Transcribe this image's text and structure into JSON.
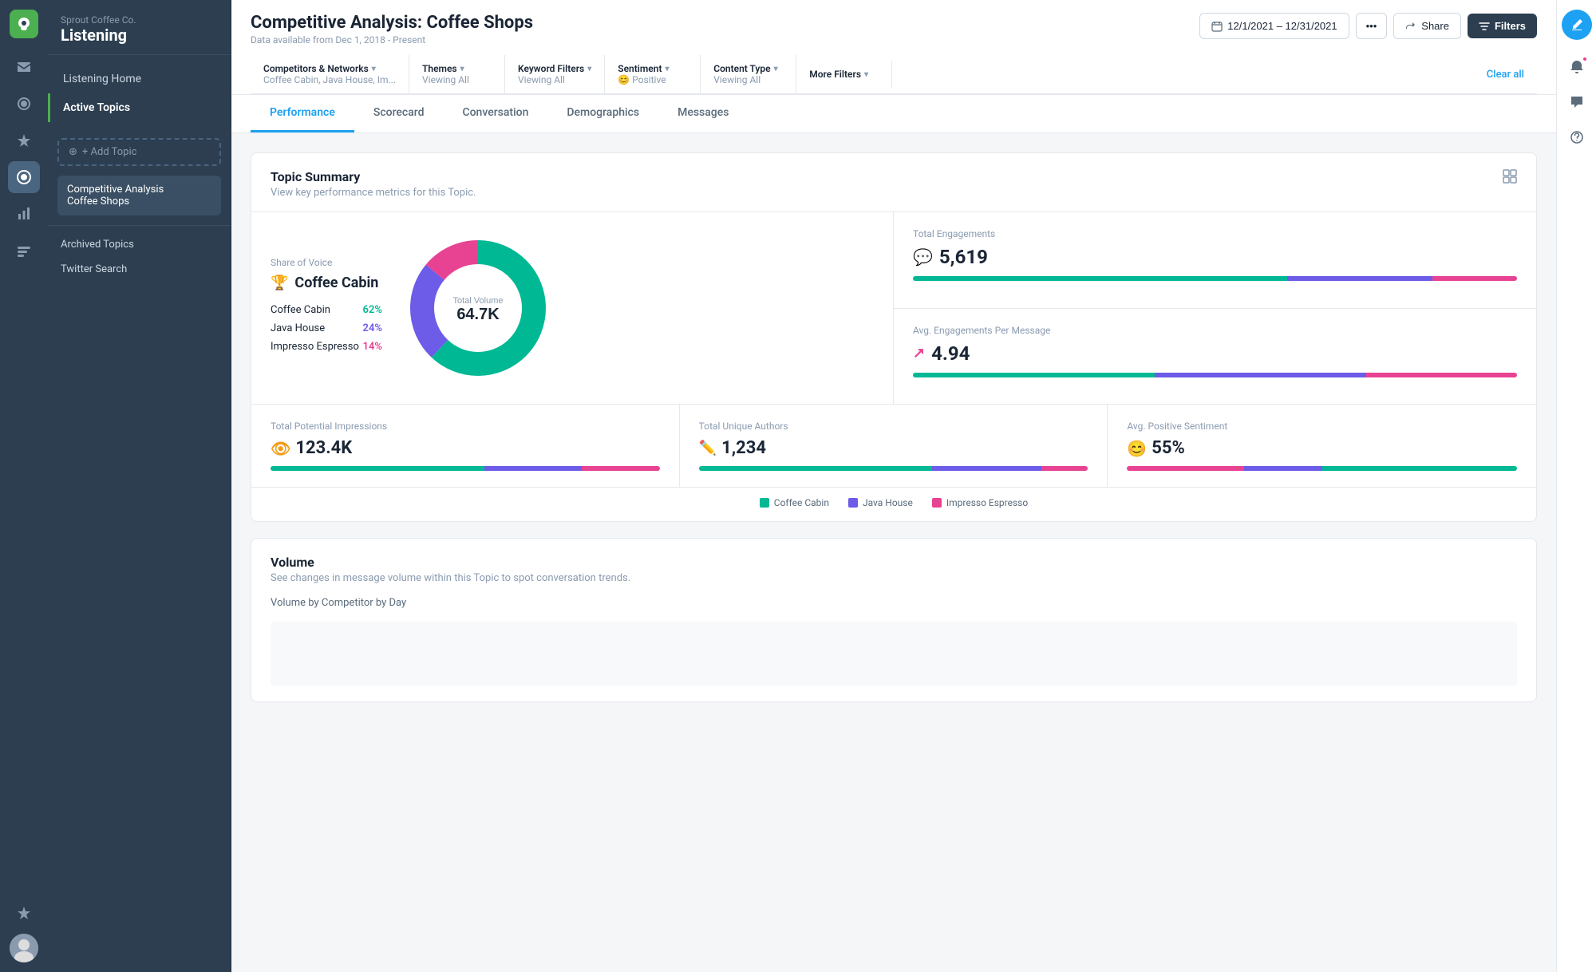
{
  "app": {
    "company": "Sprout Coffee Co.",
    "module": "Listening"
  },
  "sidebar": {
    "nav_items": [
      {
        "id": "listening-home",
        "label": "Listening Home",
        "active": false
      },
      {
        "id": "active-topics",
        "label": "Active Topics",
        "active": true
      }
    ],
    "add_topic_label": "+ Add Topic",
    "topics": [
      {
        "id": "competitive-analysis",
        "label": "Competitive Analysis\nCoffee Shops",
        "selected": true
      }
    ],
    "archived_label": "Archived Topics",
    "twitter_label": "Twitter Search"
  },
  "header": {
    "title": "Competitive Analysis: Coffee Shops",
    "subtitle": "Data available from Dec 1, 2018 - Present",
    "date_range": "12/1/2021 – 12/31/2021",
    "more_label": "•••",
    "share_label": "Share",
    "filters_label": "Filters"
  },
  "filters": {
    "items": [
      {
        "id": "competitors",
        "label": "Competitors & Networks",
        "value": "Coffee Cabin, Java House, Im..."
      },
      {
        "id": "themes",
        "label": "Themes",
        "value": "Viewing All"
      },
      {
        "id": "keyword-filters",
        "label": "Keyword Filters",
        "value": "Viewing All"
      },
      {
        "id": "sentiment",
        "label": "Sentiment",
        "value": "😊 Positive"
      },
      {
        "id": "content-type",
        "label": "Content Type",
        "value": "Viewing All"
      },
      {
        "id": "more-filters",
        "label": "More Filters",
        "value": ""
      }
    ],
    "clear_all": "Clear all"
  },
  "tabs": [
    {
      "id": "performance",
      "label": "Performance",
      "active": true
    },
    {
      "id": "scorecard",
      "label": "Scorecard",
      "active": false
    },
    {
      "id": "conversation",
      "label": "Conversation",
      "active": false
    },
    {
      "id": "demographics",
      "label": "Demographics",
      "active": false
    },
    {
      "id": "messages",
      "label": "Messages",
      "active": false
    }
  ],
  "topic_summary": {
    "title": "Topic Summary",
    "subtitle": "View key performance metrics for this Topic.",
    "share_of_voice": {
      "label": "Share of Voice",
      "winner": "Coffee Cabin",
      "items": [
        {
          "name": "Coffee Cabin",
          "pct": "62%",
          "color": "green",
          "value": 62
        },
        {
          "name": "Java House",
          "pct": "24%",
          "color": "purple",
          "value": 24
        },
        {
          "name": "Impresso Espresso",
          "pct": "14%",
          "color": "red",
          "value": 14
        }
      ]
    },
    "donut": {
      "center_label": "Total Volume",
      "center_value": "64.7K",
      "segments": [
        {
          "name": "Coffee Cabin",
          "pct": 62,
          "color": "#00b894"
        },
        {
          "name": "Java House",
          "pct": 24,
          "color": "#6c5ce7"
        },
        {
          "name": "Impresso Espresso",
          "pct": 14,
          "color": "#e84393"
        }
      ]
    },
    "total_engagements": {
      "label": "Total Engagements",
      "value": "5,619",
      "bar_segments": [
        {
          "pct": 62,
          "color": "#00b894"
        },
        {
          "pct": 24,
          "color": "#6c5ce7"
        },
        {
          "pct": 14,
          "color": "#e84393"
        }
      ]
    },
    "avg_engagements": {
      "label": "Avg. Engagements Per Message",
      "value": "4.94",
      "bar_segments": [
        {
          "pct": 40,
          "color": "#00b894"
        },
        {
          "pct": 35,
          "color": "#6c5ce7"
        },
        {
          "pct": 25,
          "color": "#e84393"
        }
      ]
    },
    "total_impressions": {
      "label": "Total Potential Impressions",
      "value": "123.4K",
      "bar_segments": [
        {
          "pct": 55,
          "color": "#00b894"
        },
        {
          "pct": 25,
          "color": "#6c5ce7"
        },
        {
          "pct": 20,
          "color": "#e84393"
        }
      ]
    },
    "total_authors": {
      "label": "Total Unique Authors",
      "value": "1,234",
      "bar_segments": [
        {
          "pct": 60,
          "color": "#00b894"
        },
        {
          "pct": 28,
          "color": "#6c5ce7"
        },
        {
          "pct": 12,
          "color": "#e84393"
        }
      ]
    },
    "avg_sentiment": {
      "label": "Avg. Positive Sentiment",
      "value": "55%",
      "bar_segments": [
        {
          "pct": 30,
          "color": "#e84393"
        },
        {
          "pct": 20,
          "color": "#6c5ce7"
        },
        {
          "pct": 50,
          "color": "#00b894"
        }
      ]
    },
    "legend": [
      {
        "label": "Coffee Cabin",
        "color": "#00b894"
      },
      {
        "label": "Java House",
        "color": "#6c5ce7"
      },
      {
        "label": "Impresso Espresso",
        "color": "#e84393"
      }
    ]
  },
  "volume": {
    "title": "Volume",
    "subtitle": "See changes in message volume within this Topic to spot conversation trends.",
    "by_label": "Volume by Competitor by Day"
  },
  "right_bar": {
    "items": [
      {
        "id": "compose",
        "icon": "✏"
      },
      {
        "id": "notifications",
        "icon": "🔔",
        "badge": true
      },
      {
        "id": "speech",
        "icon": "💬"
      },
      {
        "id": "help",
        "icon": "?"
      }
    ]
  },
  "left_icons": [
    {
      "id": "inbox",
      "icon": "✉"
    },
    {
      "id": "mentions",
      "icon": "🔔"
    },
    {
      "id": "pin",
      "icon": "📌"
    },
    {
      "id": "listen",
      "icon": "🎧",
      "active": true
    },
    {
      "id": "reports",
      "icon": "📊"
    },
    {
      "id": "bots",
      "icon": "🤖"
    },
    {
      "id": "star",
      "icon": "⭐"
    }
  ]
}
